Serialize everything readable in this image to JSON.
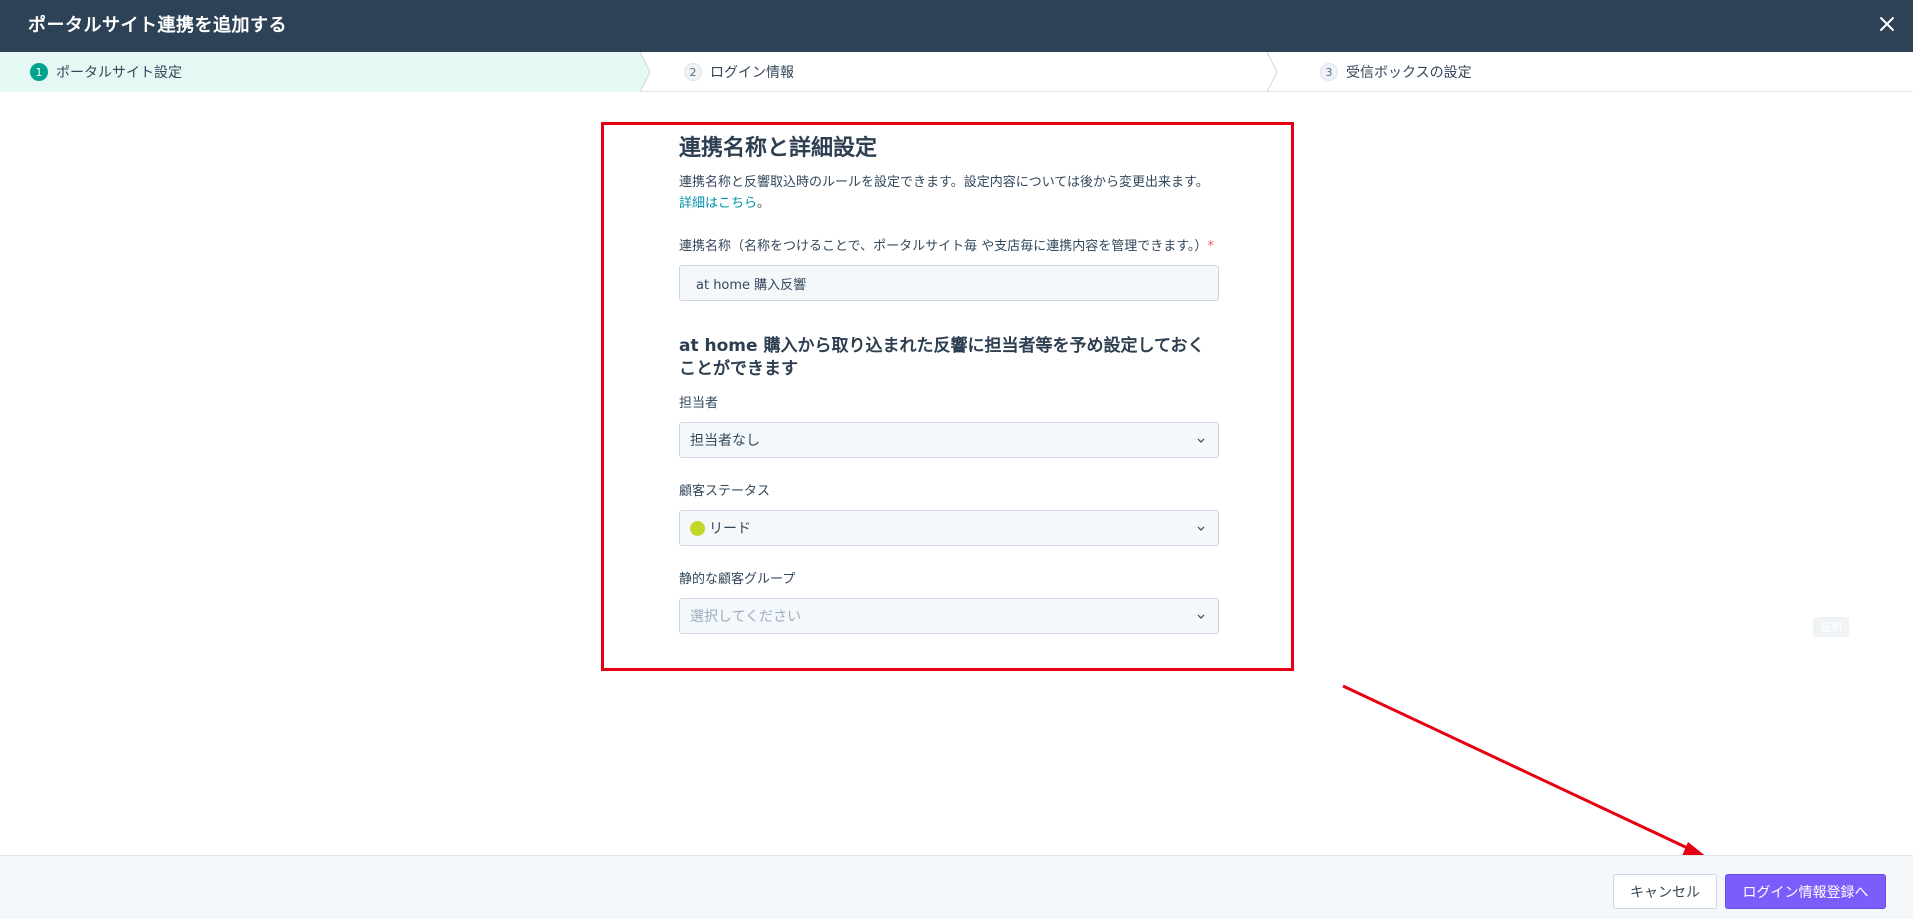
{
  "header": {
    "title": "ポータルサイト連携を追加する",
    "close_icon": "close-icon"
  },
  "steps": [
    {
      "num": "1",
      "label": "ポータルサイト設定",
      "active": true
    },
    {
      "num": "2",
      "label": "ログイン情報",
      "active": false
    },
    {
      "num": "3",
      "label": "受信ボックスの設定",
      "active": false
    }
  ],
  "form": {
    "title": "連携名称と詳細設定",
    "description": "連携名称と反響取込時のルールを設定できます。設定内容については後から変更出来ます。",
    "link_text": "詳細はこちら",
    "link_suffix": "。",
    "name_label": "連携名称（名称をつけることで、ポータルサイト毎 や支店毎に連携内容を管理できます。）",
    "required_mark": "*",
    "name_value": "at home 購入反響",
    "subheading": "at home 購入から取り込まれた反響に担当者等を予め設定しておくことができます",
    "owner_label": "担当者",
    "owner_value": "担当者なし",
    "status_label": "顧客ステータス",
    "status_value": "リード",
    "status_color": "#c3d62a",
    "group_label": "静的な顧客グループ",
    "group_placeholder": "選択してください"
  },
  "ghost_badge": "証明",
  "footer": {
    "cancel_label": "キャンセル",
    "next_label": "ログイン情報登録へ"
  },
  "colors": {
    "header_bg": "#2d4256",
    "active_step_bg": "#e5f8f4",
    "accent": "#00a38d",
    "primary_button": "#7c5cfa",
    "annotation": "#e60012"
  }
}
